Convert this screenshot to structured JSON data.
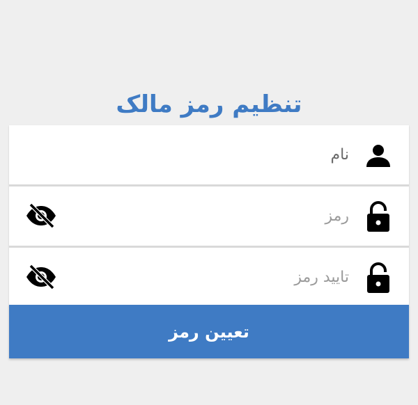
{
  "page": {
    "title": "تنظیم رمز مالک",
    "accent_color": "#3f7bc4"
  },
  "form": {
    "name_field": {
      "placeholder": "نام",
      "value": "",
      "icon": "person-icon"
    },
    "password_field": {
      "placeholder": "رمز",
      "value": "",
      "icon": "lock-icon",
      "toggle_icon": "eye-off-icon"
    },
    "confirm_field": {
      "placeholder": "تایید رمز",
      "value": "",
      "icon": "lock-icon",
      "toggle_icon": "eye-off-icon"
    },
    "submit_label": "تعیین رمز"
  }
}
